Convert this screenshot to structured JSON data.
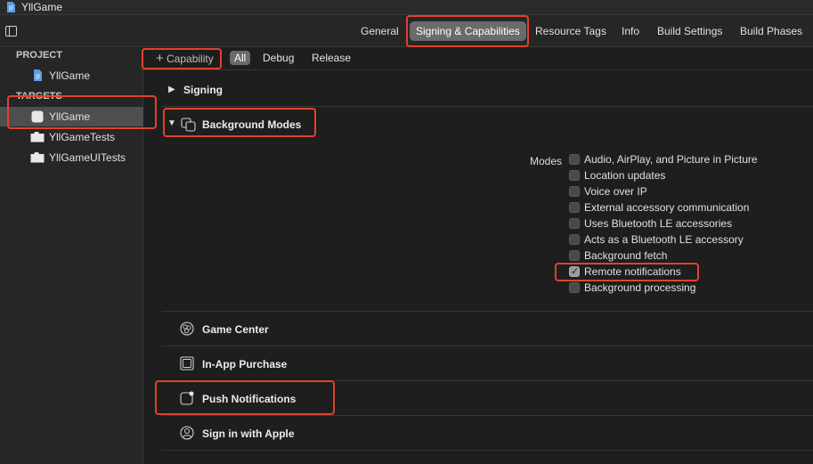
{
  "window": {
    "title": "YllGame"
  },
  "tabs": [
    {
      "label": "General",
      "selected": false
    },
    {
      "label": "Signing & Capabilities",
      "selected": true
    },
    {
      "label": "Resource Tags",
      "selected": false
    },
    {
      "label": "Info",
      "selected": false
    },
    {
      "label": "Build Settings",
      "selected": false
    },
    {
      "label": "Build Phases",
      "selected": false
    }
  ],
  "sidebar": {
    "project_header": "PROJECT",
    "project_items": [
      {
        "label": "YllGame",
        "icon": "project-file-icon"
      }
    ],
    "targets_header": "TARGETS",
    "target_items": [
      {
        "label": "YllGame",
        "icon": "app-target-icon",
        "selected": true
      },
      {
        "label": "YllGameTests",
        "icon": "test-bundle-icon",
        "selected": false
      },
      {
        "label": "YllGameUITests",
        "icon": "test-bundle-icon",
        "selected": false
      }
    ]
  },
  "filterbar": {
    "add_capability": "Capability",
    "segments": [
      {
        "label": "All",
        "active": true
      },
      {
        "label": "Debug",
        "active": false
      },
      {
        "label": "Release",
        "active": false
      }
    ]
  },
  "capabilities": {
    "signing": "Signing",
    "background_modes": "Background Modes",
    "modes_label": "Modes",
    "modes": [
      {
        "label": "Audio, AirPlay, and Picture in Picture",
        "checked": false
      },
      {
        "label": "Location updates",
        "checked": false
      },
      {
        "label": "Voice over IP",
        "checked": false
      },
      {
        "label": "External accessory communication",
        "checked": false
      },
      {
        "label": "Uses Bluetooth LE accessories",
        "checked": false
      },
      {
        "label": "Acts as a Bluetooth LE accessory",
        "checked": false
      },
      {
        "label": "Background fetch",
        "checked": false
      },
      {
        "label": "Remote notifications",
        "checked": true
      },
      {
        "label": "Background processing",
        "checked": false
      }
    ],
    "game_center": "Game Center",
    "in_app_purchase": "In-App Purchase",
    "push_notifications": "Push Notifications",
    "sign_in_with_apple": "Sign in with Apple"
  },
  "colors": {
    "highlight": "#e0422f",
    "selected_tab": "#6a6a6a",
    "background": "#1e1e1e"
  }
}
